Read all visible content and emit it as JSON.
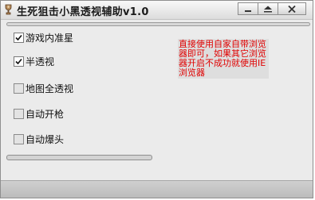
{
  "window": {
    "title": "生死狙击小黑透视辅助v1.0",
    "app_icon": "goblet-icon",
    "buttons": [
      {
        "name": "minimize",
        "icon": "minimize-icon"
      },
      {
        "name": "maximize",
        "icon": "maximize-icon"
      },
      {
        "name": "close",
        "icon": "close-icon"
      }
    ]
  },
  "options": [
    {
      "label": "游戏内准星",
      "checked": true
    },
    {
      "label": "半透视",
      "checked": true
    },
    {
      "label": "地图全透视",
      "checked": false
    },
    {
      "label": "自动开枪",
      "checked": false
    },
    {
      "label": "自动爆头",
      "checked": false
    }
  ],
  "note": {
    "text": "直接使用自家自带浏览器即可，如果其它浏览器开启不成功就使用IE浏览器",
    "color": "#e00000"
  }
}
